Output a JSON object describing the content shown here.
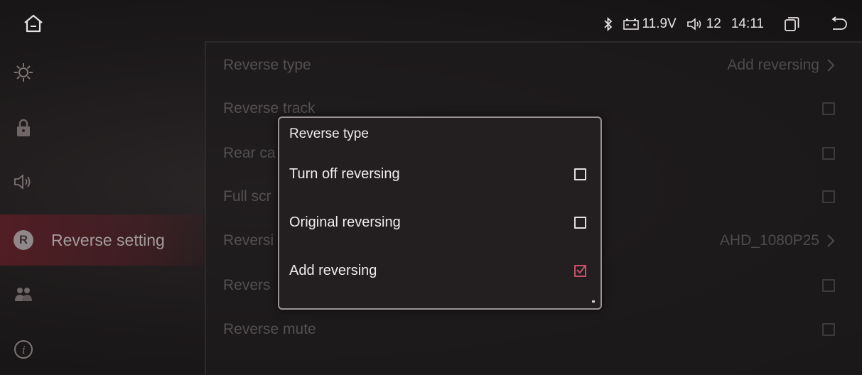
{
  "status": {
    "voltage": "11.9V",
    "volume": "12",
    "time": "14:11"
  },
  "icons": {
    "home": "home-icon",
    "bluetooth": "bluetooth-icon",
    "battery": "battery-icon",
    "volume": "speaker-icon",
    "windows": "recent-apps-icon",
    "back": "back-icon"
  },
  "sidebar": {
    "items": [
      {
        "icon": "brightness-icon",
        "label": ""
      },
      {
        "icon": "lock-icon",
        "label": ""
      },
      {
        "icon": "speaker-icon",
        "label": ""
      },
      {
        "icon": "r-badge-icon",
        "badge": "R",
        "label": "Reverse setting"
      },
      {
        "icon": "people-icon",
        "label": ""
      },
      {
        "icon": "info-icon",
        "label": ""
      }
    ]
  },
  "settings": {
    "rows": [
      {
        "label": "Reverse type",
        "value": "Add reversing"
      },
      {
        "label": "Reverse track",
        "value": ""
      },
      {
        "label": "Rear ca",
        "value": ""
      },
      {
        "label": "Full scr",
        "value": ""
      },
      {
        "label": "Reversi",
        "value": "AHD_1080P25"
      },
      {
        "label": "Revers",
        "value": ""
      },
      {
        "label": "Reverse mute",
        "value": ""
      }
    ]
  },
  "dialog": {
    "title": "Reverse type",
    "options": [
      {
        "label": "Turn off reversing",
        "checked": false
      },
      {
        "label": "Original reversing",
        "checked": false
      },
      {
        "label": "Add reversing",
        "checked": true
      }
    ]
  },
  "colors": {
    "accent": "#c9506b",
    "active_row": "#6e2630"
  }
}
